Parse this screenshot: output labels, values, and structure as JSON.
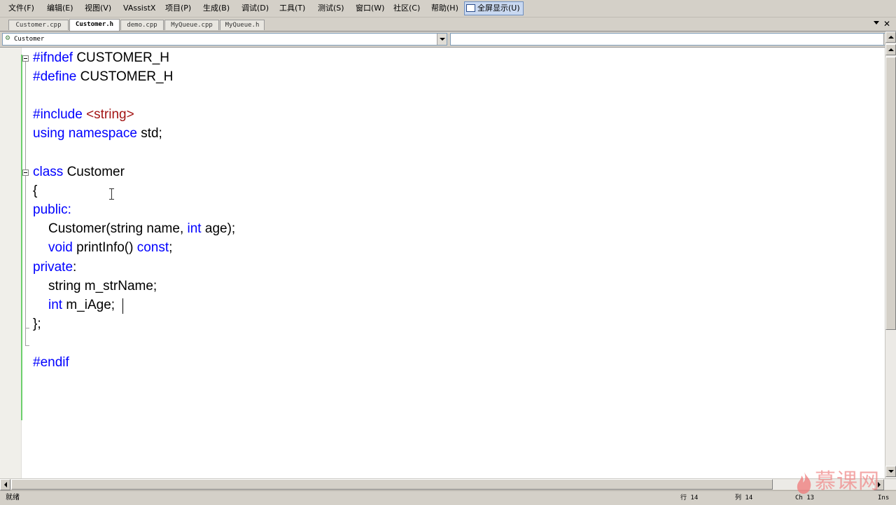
{
  "menu": {
    "items": [
      "文件(F)",
      "编辑(E)",
      "视图(V)",
      "VAssistX",
      "项目(P)",
      "生成(B)",
      "调试(D)",
      "工具(T)",
      "测试(S)",
      "窗口(W)",
      "社区(C)",
      "帮助(H)"
    ],
    "fullscreen_label": "全屏显示(U)"
  },
  "tabs": [
    {
      "label": "Customer.cpp",
      "active": false
    },
    {
      "label": "Customer.h",
      "active": true
    },
    {
      "label": "demo.cpp",
      "active": false
    },
    {
      "label": "MyQueue.cpp",
      "active": false
    },
    {
      "label": "MyQueue.h",
      "active": false
    }
  ],
  "tab_close": "✕",
  "nav": {
    "class_combo_value": "Customer",
    "member_combo_value": ""
  },
  "code": {
    "line1": {
      "a": "#ifndef",
      "b": " CUSTOMER_H"
    },
    "line2": {
      "a": "#define",
      "b": " CUSTOMER_H"
    },
    "line4": {
      "a": "#include",
      "b": " ",
      "c": "<string>"
    },
    "line5": {
      "a": "using",
      "b": " ",
      "c": "namespace",
      "d": " std;"
    },
    "line7": {
      "a": "class",
      "b": " Customer"
    },
    "line8": {
      "a": "{"
    },
    "line9": {
      "a": "public",
      "b": ":"
    },
    "line10": {
      "a": "Customer(string name, ",
      "b": "int",
      "c": " age);"
    },
    "line11": {
      "a": "void",
      "b": " printInfo() ",
      "c": "const",
      "d": ";"
    },
    "line12": {
      "a": "private",
      "b": ":"
    },
    "line13": {
      "a": "string m_strName;"
    },
    "line14": {
      "a": "int",
      "b": " m_iAge;"
    },
    "line15": {
      "a": "};"
    },
    "line17": {
      "a": "#endif"
    }
  },
  "status": {
    "ready": "就绪",
    "line": "行 14",
    "col": "列 14",
    "ch": "Ch 13",
    "mode": "Ins"
  },
  "watermark": {
    "text": "慕课网"
  },
  "colors": {
    "keyword": "#0000ff",
    "string": "#a31515",
    "change_bar": "#6ccf6c"
  }
}
